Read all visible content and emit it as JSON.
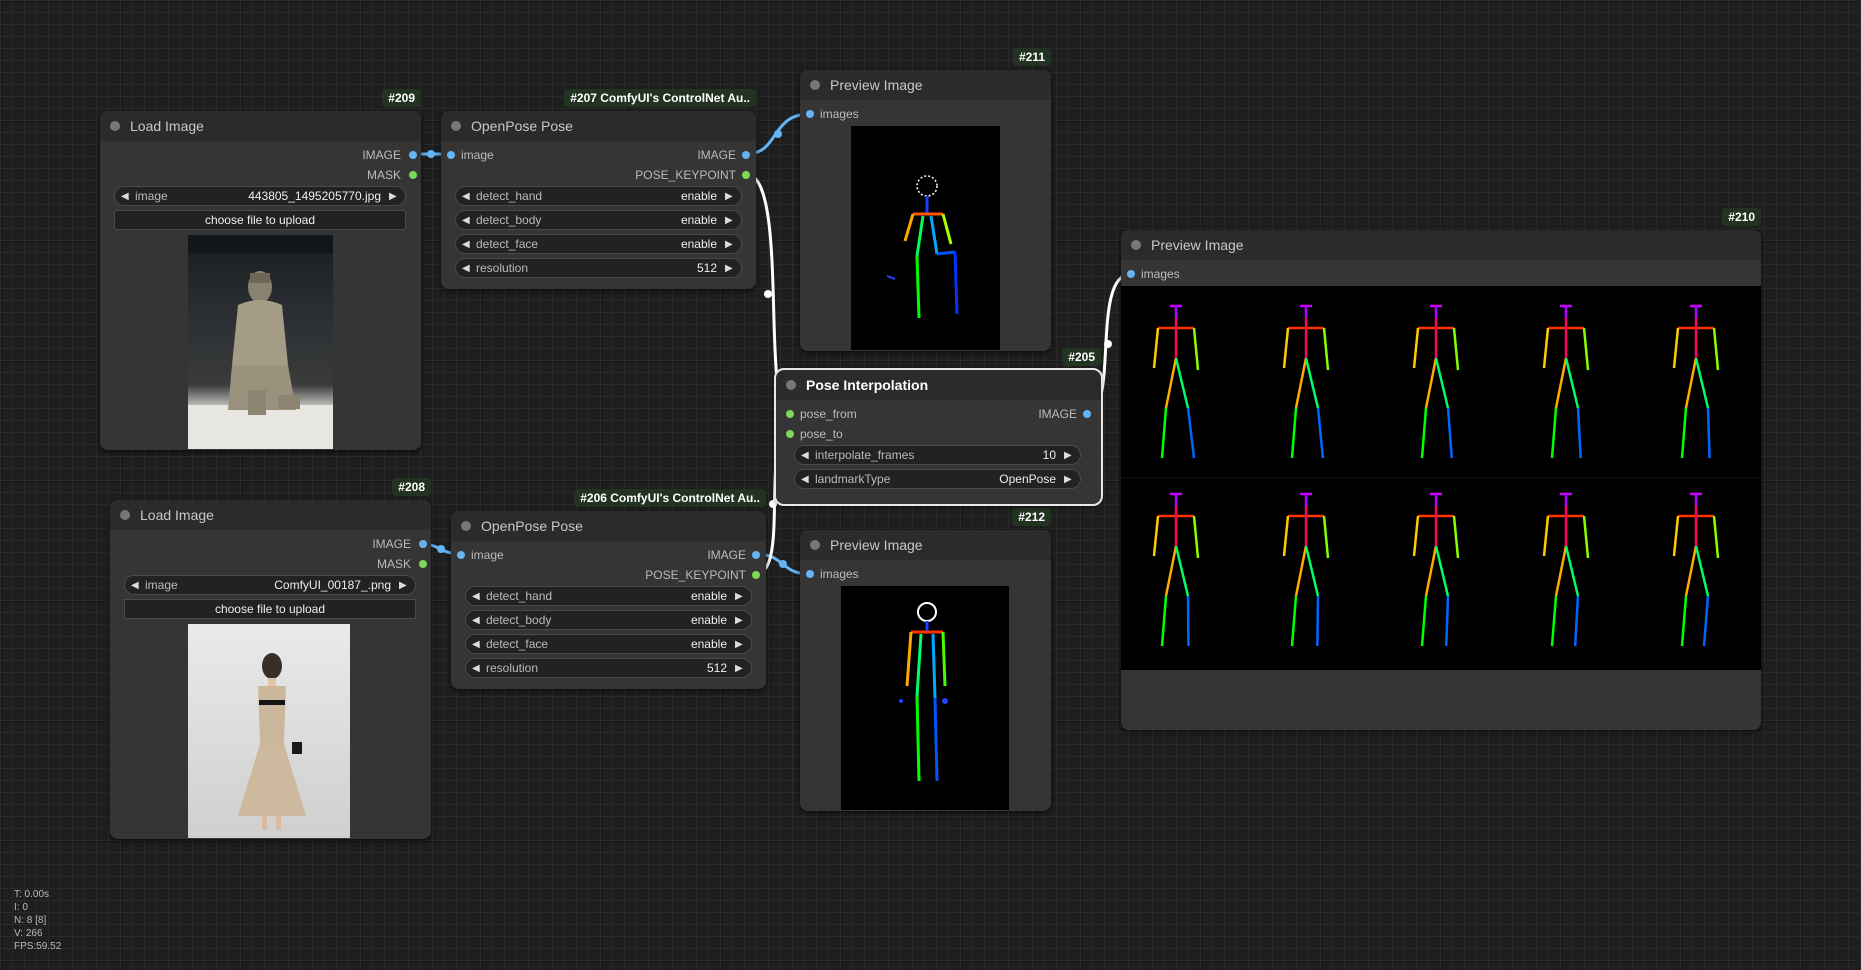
{
  "nodes": {
    "n209": {
      "id": "#209",
      "title": "Load Image",
      "outputs": [
        "IMAGE",
        "MASK"
      ],
      "image_widget": {
        "label": "image",
        "value": "443805_1495205770.jpg"
      },
      "upload_button": "choose file to upload"
    },
    "n208": {
      "id": "#208",
      "title": "Load Image",
      "outputs": [
        "IMAGE",
        "MASK"
      ],
      "image_widget": {
        "label": "image",
        "value": "ComfyUI_00187_.png"
      },
      "upload_button": "choose file to upload"
    },
    "n207": {
      "id": "#207 ComfyUI's ControlNet Au..",
      "title": "OpenPose Pose",
      "input": "image",
      "outputs": [
        "IMAGE",
        "POSE_KEYPOINT"
      ],
      "widgets": [
        {
          "label": "detect_hand",
          "value": "enable"
        },
        {
          "label": "detect_body",
          "value": "enable"
        },
        {
          "label": "detect_face",
          "value": "enable"
        },
        {
          "label": "resolution",
          "value": "512"
        }
      ]
    },
    "n206": {
      "id": "#206 ComfyUI's ControlNet Au..",
      "title": "OpenPose Pose",
      "input": "image",
      "outputs": [
        "IMAGE",
        "POSE_KEYPOINT"
      ],
      "widgets": [
        {
          "label": "detect_hand",
          "value": "enable"
        },
        {
          "label": "detect_body",
          "value": "enable"
        },
        {
          "label": "detect_face",
          "value": "enable"
        },
        {
          "label": "resolution",
          "value": "512"
        }
      ]
    },
    "n211": {
      "id": "#211",
      "title": "Preview Image",
      "input": "images"
    },
    "n212": {
      "id": "#212",
      "title": "Preview Image",
      "input": "images"
    },
    "n210": {
      "id": "#210",
      "title": "Preview Image",
      "input": "images"
    },
    "n205": {
      "id": "#205",
      "title": "Pose Interpolation",
      "inputs": [
        "pose_from",
        "pose_to"
      ],
      "output": "IMAGE",
      "widgets": [
        {
          "label": "interpolate_frames",
          "value": "10"
        },
        {
          "label": "landmarkType",
          "value": "OpenPose"
        }
      ]
    }
  },
  "stats": [
    "T: 0.00s",
    "I: 0",
    "N: 8 [8]",
    "V: 266",
    "FPS:59.52"
  ],
  "colors": {
    "image_link": "#64b5f6",
    "keypoint_link": "#ffffff",
    "mask_pin": "#7ed957",
    "node_bg": "#353535",
    "canvas_bg": "#1e1e1e"
  }
}
